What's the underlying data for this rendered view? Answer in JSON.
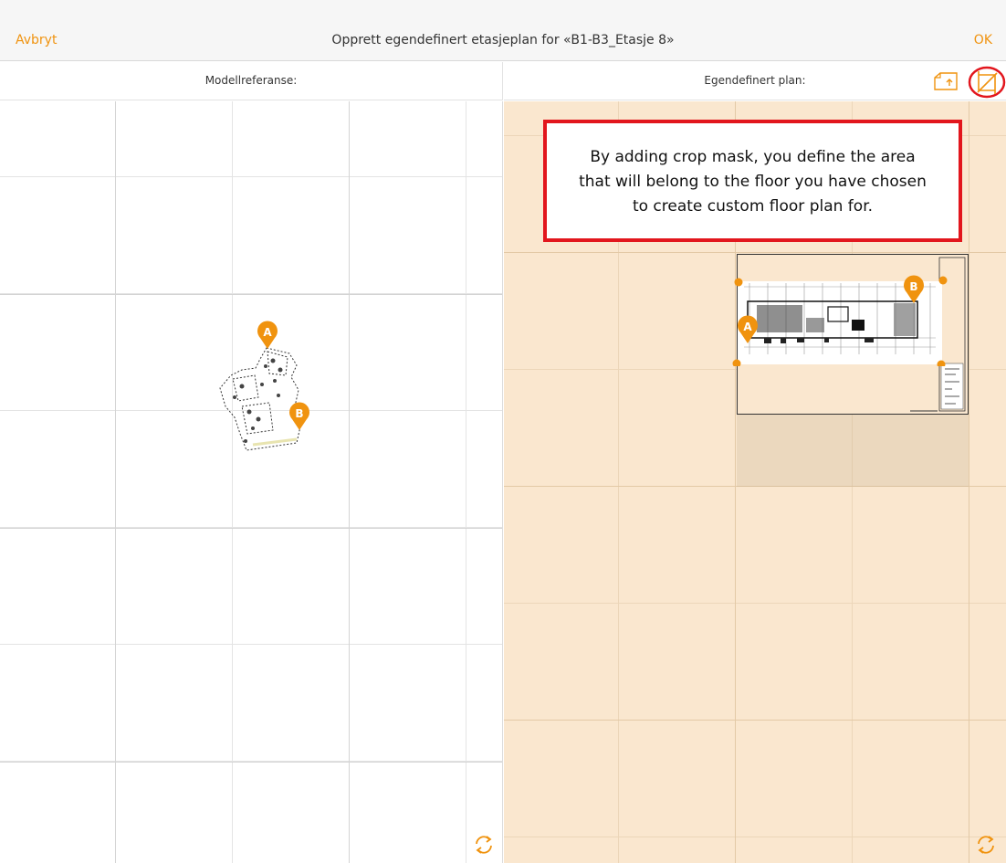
{
  "header": {
    "cancel_label": "Avbryt",
    "title": "Opprett egendefinert etasjeplan for «B1-B3_Etasje 8»",
    "ok_label": "OK"
  },
  "left_panel": {
    "title": "Modellreferanse:",
    "markers": [
      "A",
      "B"
    ]
  },
  "right_panel": {
    "title": "Egendefinert plan:",
    "markers": [
      "A",
      "B"
    ]
  },
  "tooltip": {
    "line1": "By adding crop mask, you define the area",
    "line2": "that will belong to the floor you have chosen",
    "line3": "to create custom floor plan for."
  },
  "icons": {
    "upload": "upload-plan-icon",
    "crop": "crop-mask-icon",
    "refresh": "refresh-icon",
    "marker": "map-pin-icon"
  },
  "colors": {
    "accent": "#f0930f",
    "highlight_red": "#e2161d",
    "plan_background": "#fae7cf"
  }
}
